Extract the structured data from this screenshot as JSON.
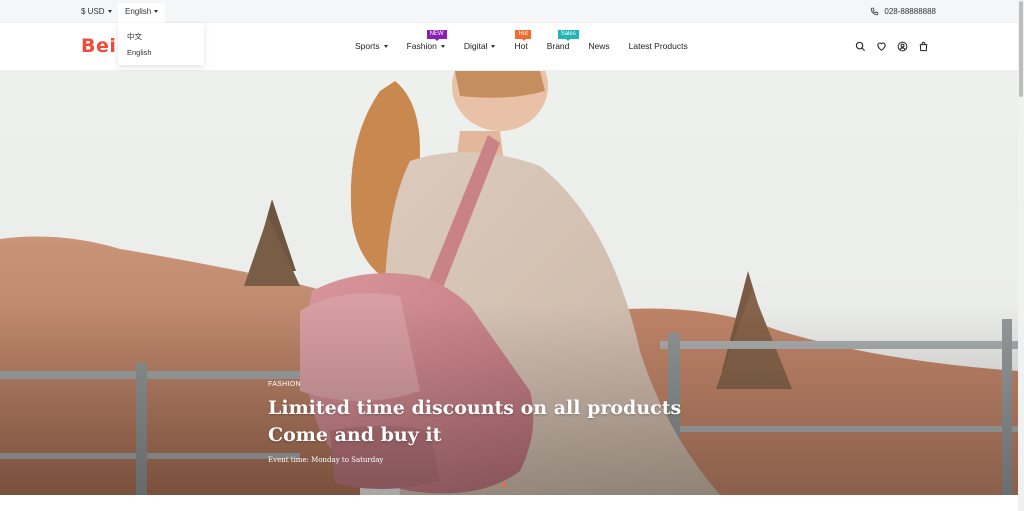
{
  "topbar": {
    "currency": "$ USD",
    "language": "English",
    "phone": "028-88888888",
    "language_options": [
      "中文",
      "English"
    ]
  },
  "header": {
    "logo": "Beik",
    "nav": [
      {
        "label": "Sports",
        "has_dropdown": true,
        "badge": ""
      },
      {
        "label": "Fashion",
        "has_dropdown": true,
        "badge": "NEW"
      },
      {
        "label": "Digital",
        "has_dropdown": true,
        "badge": ""
      },
      {
        "label": "Hot",
        "has_dropdown": false,
        "badge": "Hot"
      },
      {
        "label": "Brand",
        "has_dropdown": false,
        "badge": "Sales"
      },
      {
        "label": "News",
        "has_dropdown": false,
        "badge": ""
      },
      {
        "label": "Latest Products",
        "has_dropdown": false,
        "badge": ""
      }
    ],
    "icons": [
      "search-icon",
      "heart-icon",
      "user-icon",
      "cart-icon"
    ]
  },
  "hero": {
    "tag": "FASHION",
    "title_line1": "Limited time discounts on all products",
    "title_line2": "Come and buy it",
    "event_time": "Event time: Monday to Saturday"
  },
  "colors": {
    "brand": "#ef4a3a",
    "badge_new": "#8a1fb8",
    "badge_hot": "#f26b2f",
    "badge_sales": "#1fb6b6",
    "slider_dot": "#f26b2f"
  }
}
